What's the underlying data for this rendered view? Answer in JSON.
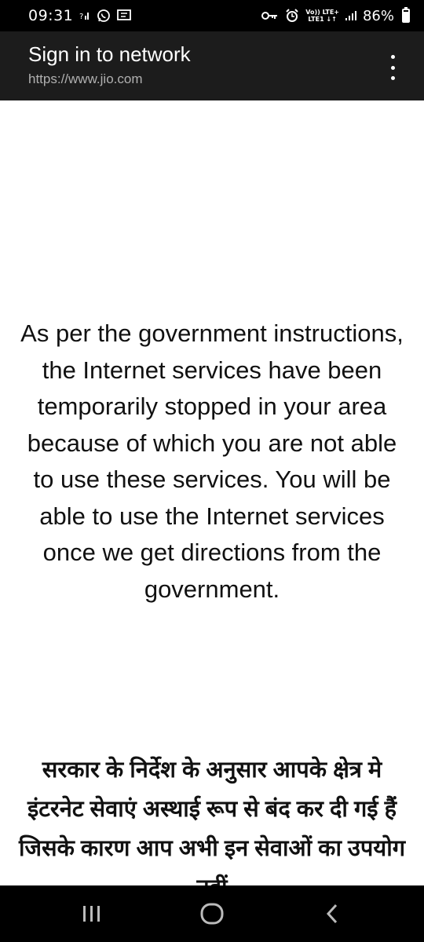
{
  "status_bar": {
    "time": "09:31",
    "left_icons": [
      "signal-alt-icon",
      "whatsapp-icon",
      "messages-icon"
    ],
    "right_icons": [
      "vpn-key-icon",
      "alarm-icon",
      "volte-lte-icon",
      "signal-bars-icon"
    ],
    "volte_top": "Vo)) LTE+",
    "volte_bottom": "LTE1 ↓↑",
    "battery_percent": "86%",
    "battery_level": 0.86
  },
  "app_bar": {
    "title": "Sign in to network",
    "url": "https://www.jio.com",
    "menu_icon": "more-vert-icon"
  },
  "content": {
    "english_message": "As per the government instructions, the Internet services have been temporarily stopped in your area because of which you are not able to use these services. You will be able to use the Internet services once we get directions from the government.",
    "hindi_message": "सरकार के निर्देश के अनुसार आपके क्षेत्र मे इंटरनेट सेवाएं अस्थाई रूप से बंद कर दी गई हैं जिसके कारण आप अभी इन सेवाओं का उपयोग नहीं"
  },
  "nav_bar": {
    "buttons": [
      "recent-apps-icon",
      "home-icon",
      "back-icon"
    ]
  }
}
